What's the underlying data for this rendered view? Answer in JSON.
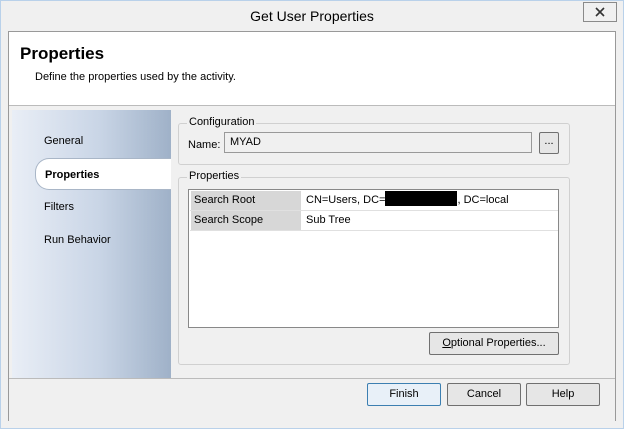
{
  "window": {
    "title": "Get User Properties"
  },
  "header": {
    "title": "Properties",
    "subtitle": "Define the properties used by the activity."
  },
  "nav": {
    "items": [
      {
        "label": "General",
        "selected": false
      },
      {
        "label": "Properties",
        "selected": true
      },
      {
        "label": "Filters",
        "selected": false
      },
      {
        "label": "Run Behavior",
        "selected": false
      }
    ]
  },
  "configuration": {
    "group_label": "Configuration",
    "name_label": "Name:",
    "name_value": "MYAD",
    "browse_label": "..."
  },
  "properties": {
    "group_label": "Properties",
    "rows": [
      {
        "key": "Search Root",
        "value_prefix": "CN=Users, DC=",
        "value_suffix": ", DC=local"
      },
      {
        "key": "Search Scope",
        "value": "Sub Tree"
      }
    ],
    "optional_button": {
      "accel": "O",
      "rest": "ptional Properties..."
    }
  },
  "footer": {
    "finish": "Finish",
    "cancel": "Cancel",
    "help": "Help"
  }
}
